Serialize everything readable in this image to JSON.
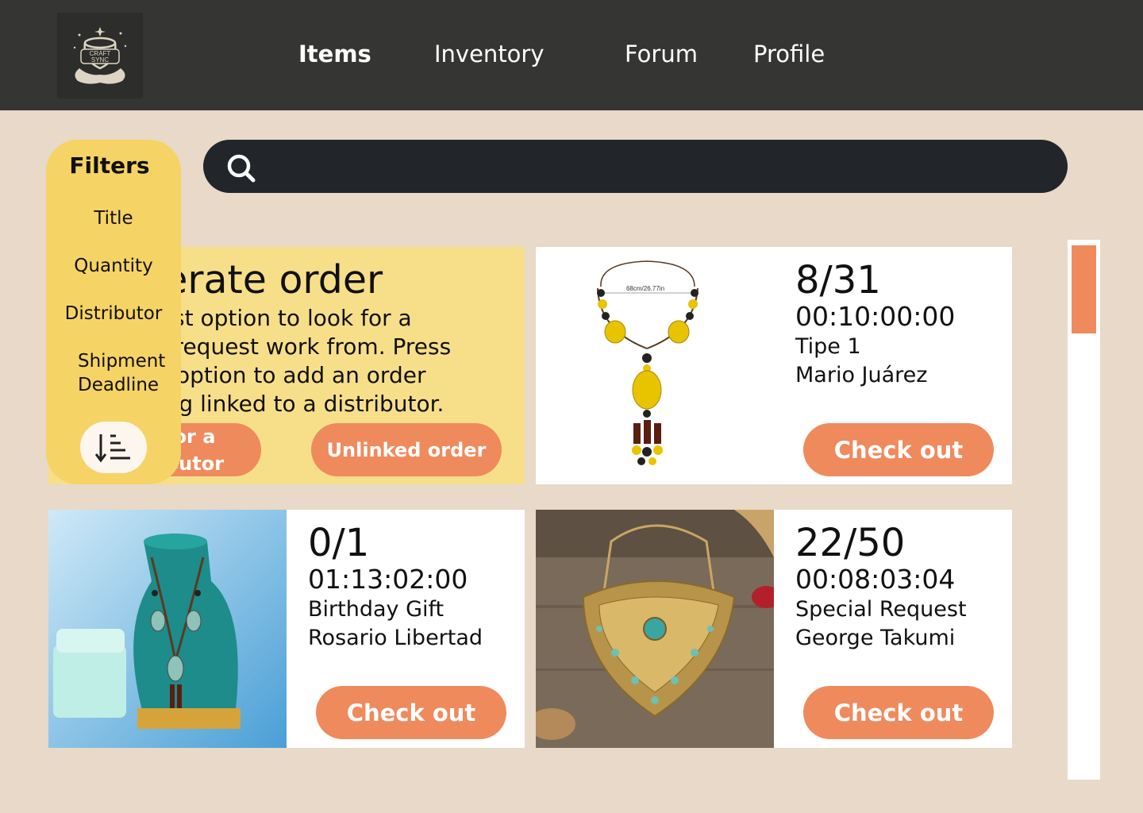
{
  "app": {
    "logo_text_line1": "CRAFT",
    "logo_text_line2": "SYNC"
  },
  "nav": {
    "items": [
      {
        "label": "Items",
        "active": true
      },
      {
        "label": "Inventory",
        "active": false
      },
      {
        "label": "Forum",
        "active": false
      },
      {
        "label": "Profile",
        "active": false
      }
    ]
  },
  "search": {
    "value": "",
    "placeholder": ""
  },
  "filters": {
    "title": "Filters",
    "options": [
      "Title",
      "Quantity",
      "Distributor",
      "Shipment Deadline"
    ]
  },
  "generate": {
    "title": "Generate order",
    "description": "Press the first option to look for a distributor to request work from. Press the second option to add an order without being linked to a distributor.",
    "visible_title": "enerate order",
    "visible_lines": [
      "he first option to look for a",
      "or to request work from. Press",
      "cond option to add an order",
      "t being linked to a distributor."
    ],
    "button1_label": "Look for a distributor",
    "button1_visible_lines": [
      "or a",
      "butor"
    ],
    "button2_label": "Unlinked order"
  },
  "orders": [
    {
      "count": "8/31",
      "timer": "00:10:00:00",
      "tag": "Tipe 1",
      "person": "Mario Juárez",
      "button": "Check out",
      "photo_label": "68cm/26.77in"
    },
    {
      "count": "0/1",
      "timer": "01:13:02:00",
      "tag": "Birthday Gift",
      "person": "Rosario Libertad",
      "button": "Check out"
    },
    {
      "count": "22/50",
      "timer": "00:08:03:04",
      "tag": "Special Request",
      "person": "George Takumi",
      "button": "Check out"
    }
  ],
  "colors": {
    "header_bg": "#353633",
    "page_bg": "#e8d9c8",
    "accent": "#ef8a5d",
    "filters_bg": "#f5d365",
    "generate_bg": "#f7df8a",
    "search_bg": "#22252a"
  },
  "icons": {
    "search": "search-icon",
    "sort": "sort-descending-icon",
    "logo": "craft-sync-logo"
  }
}
